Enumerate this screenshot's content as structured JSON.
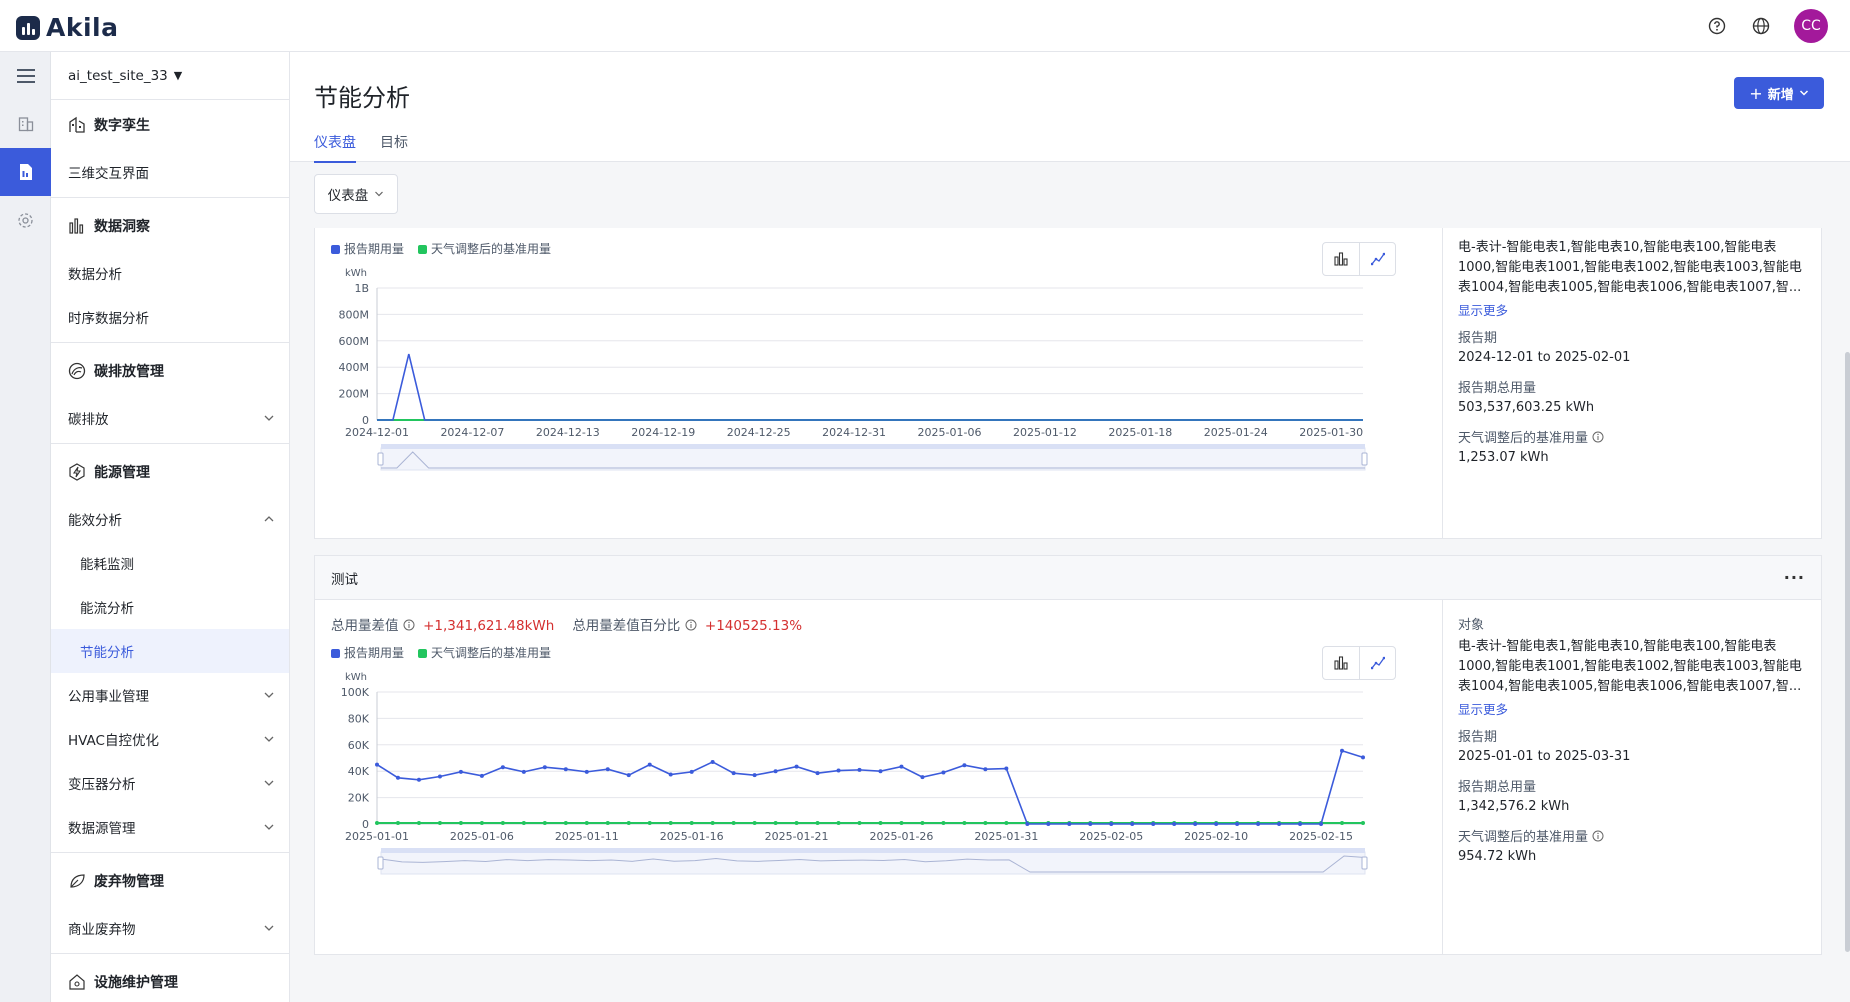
{
  "app": {
    "logo_text": "Akila",
    "avatar_initials": "CC",
    "accent": "#3b5bdb"
  },
  "site": {
    "name": "ai_test_site_33"
  },
  "sidebar": {
    "groups": [
      {
        "title": "数字孪生",
        "items": [
          {
            "label": "三维交互界面"
          }
        ]
      },
      {
        "title": "数据洞察",
        "items": [
          {
            "label": "数据分析"
          },
          {
            "label": "时序数据分析"
          }
        ]
      },
      {
        "title": "碳排放管理",
        "items": [
          {
            "label": "碳排放"
          }
        ]
      },
      {
        "title": "能源管理",
        "items": [
          {
            "label": "能效分析"
          },
          {
            "label": "能耗监测"
          },
          {
            "label": "能流分析"
          },
          {
            "label": "节能分析"
          },
          {
            "label": "公用事业管理"
          },
          {
            "label": "HVAC自控优化"
          },
          {
            "label": "变压器分析"
          },
          {
            "label": "数据源管理"
          }
        ]
      },
      {
        "title": "废弃物管理",
        "items": [
          {
            "label": "商业废弃物"
          }
        ]
      },
      {
        "title": "设施维护管理",
        "items": []
      }
    ]
  },
  "page": {
    "title": "节能分析",
    "tabs": [
      "仪表盘",
      "目标"
    ],
    "add_button": "新增",
    "dashboard_select": "仪表盘"
  },
  "legend": {
    "report": "报告期用量",
    "baseline": "天气调整后的基准用量",
    "report_color": "#3b5bdb",
    "baseline_color": "#22c55e"
  },
  "card1": {
    "info": {
      "objects": "电-表计-智能电表1,智能电表10,智能电表100,智能电表1000,智能电表1001,智能电表1002,智能电表1003,智能电表1004,智能电表1005,智能电表1006,智能电表1007,智...",
      "show_more": "显示更多",
      "period_label": "报告期",
      "period": "2024-12-01 to 2025-02-01",
      "total_label": "报告期总用量",
      "total": "503,537,603.25 kWh",
      "baseline_label": "天气调整后的基准用量",
      "baseline": "1,253.07 kWh"
    }
  },
  "card2": {
    "title": "测试",
    "more": "···",
    "stats": {
      "diff_label": "总用量差值",
      "diff_value": "+1,341,621.48kWh",
      "pct_label": "总用量差值百分比",
      "pct_value": "+140525.13%"
    },
    "info": {
      "objects_label": "对象",
      "objects": "电-表计-智能电表1,智能电表10,智能电表100,智能电表1000,智能电表1001,智能电表1002,智能电表1003,智能电表1004,智能电表1005,智能电表1006,智能电表1007,智...",
      "show_more": "显示更多",
      "period_label": "报告期",
      "period": "2025-01-01 to 2025-03-31",
      "total_label": "报告期总用量",
      "total": "1,342,576.2 kWh",
      "baseline_label": "天气调整后的基准用量",
      "baseline": "954.72 kWh"
    }
  },
  "chart_data": [
    {
      "type": "line",
      "ylabel": "kWh",
      "yticks": [
        "0",
        "200M",
        "400M",
        "600M",
        "800M",
        "1B"
      ],
      "ylim": [
        0,
        1000000000
      ],
      "xticks": [
        "2024-12-01",
        "2024-12-07",
        "2024-12-13",
        "2024-12-19",
        "2024-12-25",
        "2024-12-31",
        "2025-01-06",
        "2025-01-12",
        "2025-01-18",
        "2025-01-24",
        "2025-01-30"
      ],
      "x_count": 63,
      "series": [
        {
          "name": "报告期用量",
          "values": [
            0,
            0,
            500000000,
            0,
            0,
            0,
            0,
            0,
            0,
            0,
            0,
            0,
            0,
            0,
            0,
            0,
            0,
            0,
            0,
            0,
            0,
            0,
            0,
            0,
            0,
            0,
            0,
            0,
            0,
            0,
            0,
            0,
            0,
            0,
            0,
            0,
            0,
            0,
            0,
            0,
            0,
            0,
            0,
            0,
            0,
            0,
            0,
            0,
            0,
            0,
            0,
            0,
            0,
            0,
            0,
            0,
            0,
            0,
            0,
            0,
            0,
            0,
            0
          ]
        },
        {
          "name": "天气调整后的基准用量",
          "values": [
            0,
            0,
            0,
            0,
            0,
            0,
            0,
            0,
            0,
            0,
            0,
            0,
            0,
            0,
            0,
            0,
            0,
            0,
            0,
            0,
            0,
            0,
            0,
            0,
            0,
            0,
            0,
            0,
            0,
            0,
            0,
            0,
            0,
            0,
            0,
            0,
            0,
            0,
            0,
            0,
            0,
            0,
            0,
            0,
            0,
            0,
            0,
            0,
            0,
            0,
            0,
            0,
            0,
            0,
            0,
            0,
            0,
            0,
            0,
            0,
            0,
            0,
            0
          ]
        }
      ]
    },
    {
      "type": "line",
      "ylabel": "kWh",
      "yticks": [
        "0",
        "20K",
        "40K",
        "60K",
        "80K",
        "100K"
      ],
      "ylim": [
        0,
        100000
      ],
      "xticks": [
        "2025-01-01",
        "2025-01-06",
        "2025-01-11",
        "2025-01-16",
        "2025-01-21",
        "2025-01-26",
        "2025-01-31",
        "2025-02-05",
        "2025-02-10",
        "2025-02-15"
      ],
      "x_count": 48,
      "series": [
        {
          "name": "报告期用量",
          "values": [
            45000,
            35000,
            33500,
            36000,
            39500,
            36500,
            43000,
            39500,
            43000,
            41500,
            39500,
            41500,
            37000,
            45000,
            37500,
            39500,
            47000,
            38500,
            37000,
            40000,
            43500,
            38500,
            40500,
            41000,
            40000,
            43500,
            35500,
            39000,
            44500,
            41500,
            42000,
            0,
            0,
            0,
            0,
            0,
            0,
            0,
            0,
            0,
            0,
            0,
            0,
            0,
            0,
            0,
            55500,
            50500
          ]
        },
        {
          "name": "天气调整后的基准用量",
          "values": [
            800,
            800,
            800,
            800,
            800,
            800,
            800,
            800,
            800,
            800,
            800,
            800,
            800,
            800,
            800,
            800,
            800,
            800,
            800,
            800,
            800,
            800,
            800,
            800,
            800,
            800,
            800,
            800,
            800,
            800,
            800,
            800,
            800,
            800,
            800,
            800,
            800,
            800,
            800,
            800,
            800,
            800,
            800,
            800,
            800,
            800,
            800,
            800
          ]
        }
      ]
    }
  ]
}
